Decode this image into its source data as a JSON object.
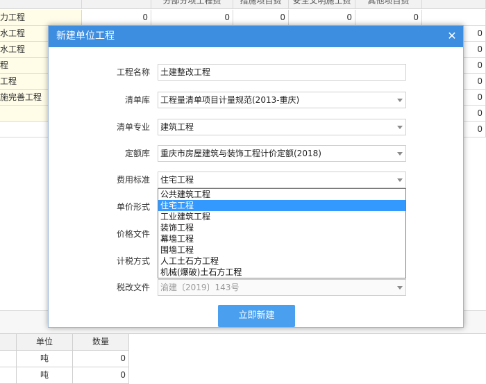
{
  "background": {
    "header_cols": [
      "分部分项工程费",
      "措施项目费",
      "安全文明施工费",
      "其他项目费"
    ],
    "rows": [
      {
        "name": "力工程",
        "values": [
          "0",
          "0",
          "0",
          "0",
          "0"
        ]
      },
      {
        "name": "水工程",
        "values": []
      },
      {
        "name": "水工程",
        "values": []
      },
      {
        "name": "程",
        "values": []
      },
      {
        "name": "工程",
        "values": []
      },
      {
        "name": "施完善工程",
        "values": []
      },
      {
        "name": "",
        "values": []
      },
      {
        "name": "",
        "values": []
      }
    ],
    "right_zeros": [
      "0",
      "0",
      "0",
      "0",
      "0",
      "0",
      "0"
    ]
  },
  "bottom_table": {
    "headers": [
      "单位",
      "数量"
    ],
    "rows": [
      {
        "unit": "吨",
        "qty": "0"
      },
      {
        "unit": "吨",
        "qty": "0"
      }
    ]
  },
  "dialog": {
    "title": "新建单位工程",
    "close_glyph": "✕",
    "fields": {
      "project_name": {
        "label": "工程名称",
        "value": "土建整改工程"
      },
      "bill_library": {
        "label": "清单库",
        "value": "工程量清单项目计量规范(2013-重庆)"
      },
      "bill_specialty": {
        "label": "清单专业",
        "value": "建筑工程"
      },
      "quota_library": {
        "label": "定额库",
        "value": "重庆市房屋建筑与装饰工程计价定额(2018)"
      },
      "fee_standard": {
        "label": "费用标准",
        "value": "住宅工程"
      },
      "unit_price_form": {
        "label": "单价形式"
      },
      "price_file": {
        "label": "价格文件"
      },
      "tax_method": {
        "label": "计税方式"
      },
      "tax_file": {
        "label": "税改文件",
        "value": "渝建〔2019〕143号"
      }
    },
    "fee_options": [
      "公共建筑工程",
      "住宅工程",
      "工业建筑工程",
      "装饰工程",
      "幕墙工程",
      "围墙工程",
      "人工土石方工程",
      "机械(爆破)土石方工程"
    ],
    "fee_selected_index": 1,
    "create_button": "立即新建"
  },
  "colors": {
    "title_bar": "#3d8de0",
    "button": "#4aa0ef",
    "selection": "#3399ff",
    "row_highlight": "#fffde8"
  }
}
